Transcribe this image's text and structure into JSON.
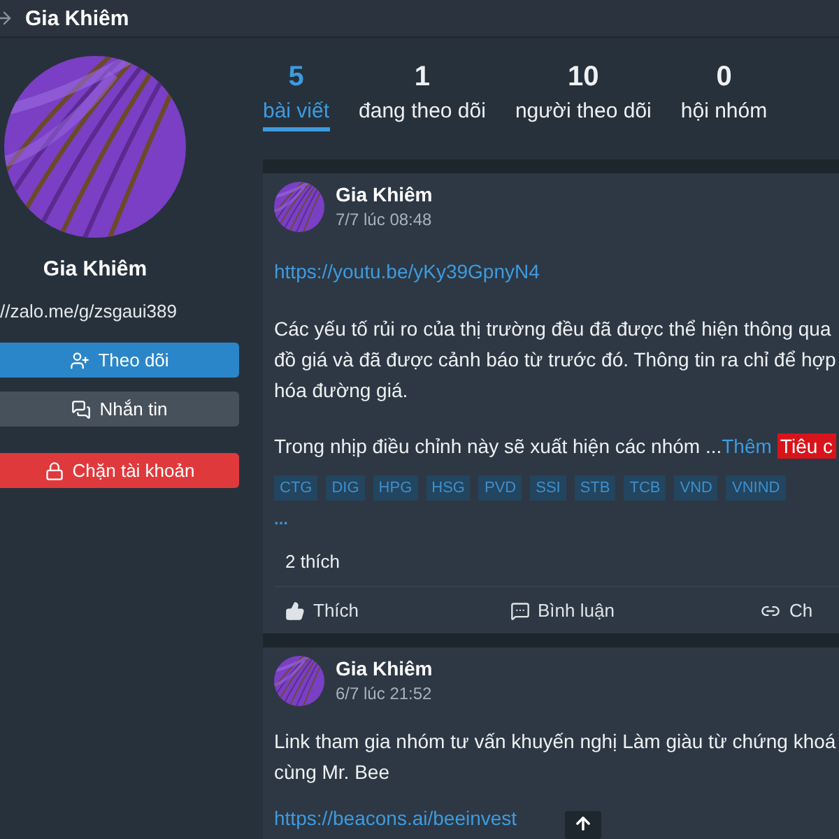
{
  "header": {
    "title": "Gia Khiêm"
  },
  "profile": {
    "name": "Gia Khiêm",
    "link": "//zalo.me/g/zsgaui389",
    "buttons": [
      {
        "kind": "follow",
        "label": "Theo dõi"
      },
      {
        "kind": "message",
        "label": "Nhắn tin"
      },
      {
        "kind": "block",
        "label": "Chặn tài khoản"
      }
    ]
  },
  "stats": [
    {
      "value": "5",
      "label": "bài viết",
      "selected": true
    },
    {
      "value": "1",
      "label": "đang theo dõi",
      "selected": false
    },
    {
      "value": "10",
      "label": "người theo dõi",
      "selected": false
    },
    {
      "value": "0",
      "label": "hội nhóm",
      "selected": false
    }
  ],
  "posts": [
    {
      "author": "Gia Khiêm",
      "time": "7/7 lúc 08:48",
      "top_link": "https://youtu.be/yKy39GpnyN4",
      "paragraphs": [
        {
          "lines": [
            "Các yếu tố rủi ro của thị trường đều đã được thể hiện thông qua",
            "đồ giá và đã được cảnh báo từ trước đó. Thông tin ra chỉ để hợp",
            "hóa đường giá."
          ]
        },
        {
          "lines": [
            "Trong nhịp điều chỉnh này sẽ xuất hiện các nhóm ..."
          ]
        }
      ],
      "more_link": "Thêm",
      "badge": "Tiêu c",
      "tags": [
        "CTG",
        "DIG",
        "HPG",
        "HSG",
        "PVD",
        "SSI",
        "STB",
        "TCB",
        "VND",
        "VNIND"
      ],
      "tags_more": "...",
      "likes": "2 thích",
      "actions": [
        {
          "kind": "like",
          "label": "Thích"
        },
        {
          "kind": "comment",
          "label": "Bình luận"
        },
        {
          "kind": "share",
          "label": "Ch"
        }
      ]
    },
    {
      "author": "Gia Khiêm",
      "time": "6/7 lúc 21:52",
      "paragraphs": [
        {
          "lines": [
            "Link tham gia nhóm tư vấn khuyến nghị Làm giàu từ chứng khoá",
            "cùng Mr. Bee"
          ]
        }
      ],
      "bottom_link": "https://beacons.ai/beeinvest"
    }
  ]
}
